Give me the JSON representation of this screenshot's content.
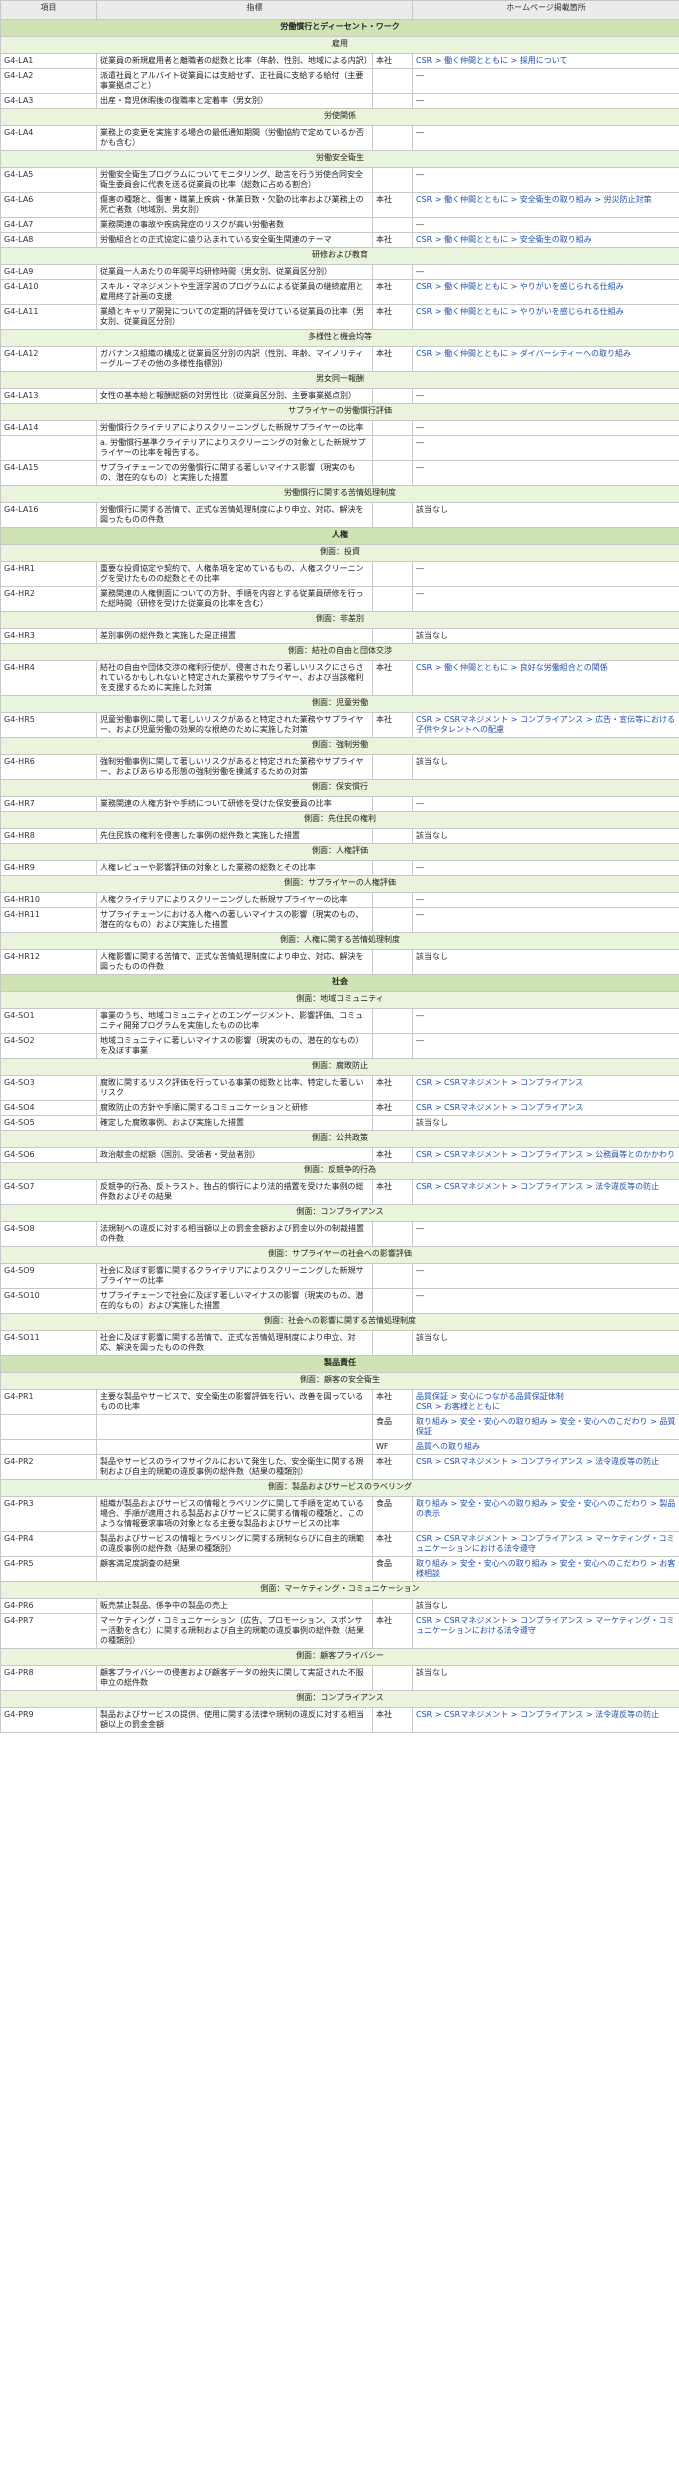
{
  "columns": [
    "項目",
    "指標",
    "",
    "ホームページ掲載箇所"
  ],
  "groups": [
    {
      "type": "section",
      "label": "労働慣行とディーセント・ワーク"
    },
    {
      "type": "sub",
      "label": "雇用"
    },
    {
      "type": "item",
      "code": "G4-LA1",
      "indicator": "従業員の新規雇用者と離職者の総数と比率（年齢、性別、地域による内訳）",
      "scope": "本社",
      "page": "CSR > 働く仲間とともに > 採用について"
    },
    {
      "type": "item",
      "code": "G4-LA2",
      "indicator": "派遣社員とアルバイト従業員には支給せず、正社員に支給する給付（主要事業拠点ごと）",
      "scope": "",
      "page": "―"
    },
    {
      "type": "item",
      "code": "G4-LA3",
      "indicator": "出産・育児休暇後の復職率と定着率（男女別）",
      "scope": "",
      "page": "―"
    },
    {
      "type": "sub",
      "label": "労使関係"
    },
    {
      "type": "item",
      "code": "G4-LA4",
      "indicator": "業務上の変更を実施する場合の最低通知期間（労働協約で定めているか否かも含む）",
      "scope": "",
      "page": "―"
    },
    {
      "type": "sub",
      "label": "労働安全衛生"
    },
    {
      "type": "item",
      "code": "G4-LA5",
      "indicator": "労働安全衛生プログラムについてモニタリング、助言を行う労使合同安全衛生委員会に代表を送る従業員の比率（総数に占める割合）",
      "scope": "",
      "page": "―"
    },
    {
      "type": "item",
      "code": "G4-LA6",
      "indicator": "傷害の種類と、傷害・職業上疾病・休業日数・欠勤の比率および業務上の死亡者数（地域別、男女別）",
      "scope": "本社",
      "page": "CSR > 働く仲間とともに > 安全衛生の取り組み > 労災防止対策"
    },
    {
      "type": "item",
      "code": "G4-LA7",
      "indicator": "業務関連の事故や疾病発症のリスクが高い労働者数",
      "scope": "",
      "page": "―"
    },
    {
      "type": "item",
      "code": "G4-LA8",
      "indicator": "労働組合との正式協定に盛り込まれている安全衛生関連のテーマ",
      "scope": "本社",
      "page": "CSR > 働く仲間とともに > 安全衛生の取り組み"
    },
    {
      "type": "sub",
      "label": "研修および教育"
    },
    {
      "type": "item",
      "code": "G4-LA9",
      "indicator": "従業員一人あたりの年間平均研修時間（男女別、従業員区分別）",
      "scope": "",
      "page": "―"
    },
    {
      "type": "item",
      "code": "G4-LA10",
      "indicator": "スキル・マネジメントや生涯学習のプログラムによる従業員の継続雇用と雇用終了計画の支援",
      "scope": "本社",
      "page": "CSR > 働く仲間とともに > やりがいを感じられる仕組み"
    },
    {
      "type": "item",
      "code": "G4-LA11",
      "indicator": "業績とキャリア開発についての定期的評価を受けている従業員の比率（男女別、従業員区分別）",
      "scope": "本社",
      "page": "CSR > 働く仲間とともに > やりがいを感じられる仕組み"
    },
    {
      "type": "sub",
      "label": "多様性と機会均等"
    },
    {
      "type": "item",
      "code": "G4-LA12",
      "indicator": "ガバナンス組織の構成と従業員区分別の内訳（性別、年齢、マイノリティーグループその他の多様性指標別）",
      "scope": "本社",
      "page": "CSR > 働く仲間とともに > ダイバーシティーへの取り組み"
    },
    {
      "type": "sub",
      "label": "男女同一報酬"
    },
    {
      "type": "item",
      "code": "G4-LA13",
      "indicator": "女性の基本給と報酬総額の対男性比（従業員区分別、主要事業拠点別）",
      "scope": "",
      "page": "―"
    },
    {
      "type": "sub",
      "label": "サプライヤーの労働慣行評価"
    },
    {
      "type": "item",
      "code": "G4-LA14",
      "indicator": "労働慣行クライテリアによりスクリーニングした新規サプライヤーの比率",
      "scope": "",
      "page": "―"
    },
    {
      "type": "item",
      "code": "",
      "indicator": "a. 労働慣行基準クライテリアによりスクリーニングの対象とした新規サプライヤーの比率を報告する。",
      "scope": "",
      "page": "―"
    },
    {
      "type": "item",
      "code": "G4-LA15",
      "indicator": "サプライチェーンでの労働慣行に関する著しいマイナス影響（現実のもの、潜在的なもの）と実施した措置",
      "scope": "",
      "page": "―"
    },
    {
      "type": "sub",
      "label": "労働慣行に関する苦情処理制度"
    },
    {
      "type": "item",
      "code": "G4-LA16",
      "indicator": "労働慣行に関する苦情で、正式な苦情処理制度により申立、対応、解決を図ったものの件数",
      "scope": "",
      "page": "該当なし"
    },
    {
      "type": "section",
      "label": "人権"
    },
    {
      "type": "sub",
      "label": "側面：投資"
    },
    {
      "type": "item",
      "code": "G4-HR1",
      "indicator": "重要な投資協定や契約で、人権条項を定めているもの、人権スクリーニングを受けたものの総数とその比率",
      "scope": "",
      "page": "―"
    },
    {
      "type": "item",
      "code": "G4-HR2",
      "indicator": "業務関連の人権側面についての方針、手順を内容とする従業員研修を行った総時間（研修を受けた従業員の比率を含む）",
      "scope": "",
      "page": "―"
    },
    {
      "type": "sub",
      "label": "側面：非差別"
    },
    {
      "type": "item",
      "code": "G4-HR3",
      "indicator": "差別事例の総件数と実施した是正措置",
      "scope": "",
      "page": "該当なし"
    },
    {
      "type": "sub",
      "label": "側面：結社の自由と団体交渉"
    },
    {
      "type": "item",
      "code": "G4-HR4",
      "indicator": "結社の自由や団体交渉の権利行使が、侵害されたり著しいリスクにさらされているかもしれないと特定された業務やサプライヤー、および当該権利を支援するために実施した対策",
      "scope": "本社",
      "page": "CSR > 働く仲間とともに > 良好な労働組合との関係"
    },
    {
      "type": "sub",
      "label": "側面：児童労働"
    },
    {
      "type": "item",
      "code": "G4-HR5",
      "indicator": "児童労働事例に関して著しいリスクがあると特定された業務やサプライヤー、および児童労働の効果的な根絶のために実施した対策",
      "scope": "本社",
      "page": "CSR > CSRマネジメント > コンプライアンス > 広告・宣伝等における子供やタレントへの配慮"
    },
    {
      "type": "sub",
      "label": "側面：強制労働"
    },
    {
      "type": "item",
      "code": "G4-HR6",
      "indicator": "強制労働事例に関して著しいリスクがあると特定された業務やサプライヤー、およびあらゆる形態の強制労働を撲滅するための対策",
      "scope": "",
      "page": "該当なし"
    },
    {
      "type": "sub",
      "label": "側面：保安慣行"
    },
    {
      "type": "item",
      "code": "G4-HR7",
      "indicator": "業務関連の人権方針や手続について研修を受けた保安要員の比率",
      "scope": "",
      "page": "―"
    },
    {
      "type": "sub",
      "label": "側面：先住民の権利"
    },
    {
      "type": "item",
      "code": "G4-HR8",
      "indicator": "先住民族の権利を侵害した事例の総件数と実施した措置",
      "scope": "",
      "page": "該当なし"
    },
    {
      "type": "sub",
      "label": "側面：人権評価"
    },
    {
      "type": "item",
      "code": "G4-HR9",
      "indicator": "人権レビューや影響評価の対象とした業務の総数とその比率",
      "scope": "",
      "page": "―"
    },
    {
      "type": "sub",
      "label": "側面：サプライヤーの人権評価"
    },
    {
      "type": "item",
      "code": "G4-HR10",
      "indicator": "人権クライテリアによりスクリーニングした新規サプライヤーの比率",
      "scope": "",
      "page": "―"
    },
    {
      "type": "item",
      "code": "G4-HR11",
      "indicator": "サプライチェーンにおける人権への著しいマイナスの影響（現実のもの、潜在的なもの）および実施した措置",
      "scope": "",
      "page": "―"
    },
    {
      "type": "sub",
      "label": "側面：人権に関する苦情処理制度"
    },
    {
      "type": "item",
      "code": "G4-HR12",
      "indicator": "人権影響に関する苦情で、正式な苦情処理制度により申立、対応、解決を図ったものの件数",
      "scope": "",
      "page": "該当なし"
    },
    {
      "type": "section",
      "label": "社会"
    },
    {
      "type": "sub",
      "label": "側面：地域コミュニティ"
    },
    {
      "type": "item",
      "code": "G4-SO1",
      "indicator": "事業のうち、地域コミュニティとのエンゲージメント、影響評価、コミュニティ開発プログラムを実施したものの比率",
      "scope": "",
      "page": "―"
    },
    {
      "type": "item",
      "code": "G4-SO2",
      "indicator": "地域コミュニティに著しいマイナスの影響（現実のもの、潜在的なもの）を及ぼす事業",
      "scope": "",
      "page": "―"
    },
    {
      "type": "sub",
      "label": "側面：腐敗防止"
    },
    {
      "type": "item",
      "code": "G4-SO3",
      "indicator": "腐敗に関するリスク評価を行っている事業の総数と比率、特定した著しいリスク",
      "scope": "本社",
      "page": "CSR > CSRマネジメント > コンプライアンス"
    },
    {
      "type": "item",
      "code": "G4-SO4",
      "indicator": "腐敗防止の方針や手順に関するコミュニケーションと研修",
      "scope": "本社",
      "page": "CSR > CSRマネジメント > コンプライアンス"
    },
    {
      "type": "item",
      "code": "G4-SO5",
      "indicator": "確定した腐敗事例、および実施した措置",
      "scope": "",
      "page": "該当なし"
    },
    {
      "type": "sub",
      "label": "側面：公共政策"
    },
    {
      "type": "item",
      "code": "G4-SO6",
      "indicator": "政治献金の総額（国別、受領者・受益者別）",
      "scope": "本社",
      "page": "CSR > CSRマネジメント > コンプライアンス > 公務員等とのかかわり"
    },
    {
      "type": "sub",
      "label": "側面：反競争的行為"
    },
    {
      "type": "item",
      "code": "G4-SO7",
      "indicator": "反競争的行為、反トラスト、独占的慣行により法的措置を受けた事例の総件数およびその結果",
      "scope": "本社",
      "page": "CSR > CSRマネジメント > コンプライアンス > 法令違反等の防止"
    },
    {
      "type": "sub",
      "label": "側面：コンプライアンス"
    },
    {
      "type": "item",
      "code": "G4-SO8",
      "indicator": "法規制への違反に対する相当額以上の罰金金額および罰金以外の制裁措置の件数",
      "scope": "",
      "page": "―"
    },
    {
      "type": "sub",
      "label": "側面：サプライヤーの社会への影響評価"
    },
    {
      "type": "item",
      "code": "G4-SO9",
      "indicator": "社会に及ぼす影響に関するクライテリアによりスクリーニングした新規サプライヤーの比率",
      "scope": "",
      "page": "―"
    },
    {
      "type": "item",
      "code": "G4-SO10",
      "indicator": "サプライチェーンで社会に及ぼす著しいマイナスの影響（現実のもの、潜在的なもの）および実施した措置",
      "scope": "",
      "page": "―"
    },
    {
      "type": "sub",
      "label": "側面：社会への影響に関する苦情処理制度"
    },
    {
      "type": "item",
      "code": "G4-SO11",
      "indicator": "社会に及ぼす影響に関する苦情で、正式な苦情処理制度により申立、対応、解決を図ったものの件数",
      "scope": "",
      "page": "該当なし"
    },
    {
      "type": "section",
      "label": "製品責任"
    },
    {
      "type": "sub",
      "label": "側面：顧客の安全衛生"
    },
    {
      "type": "item",
      "code": "G4-PR1",
      "indicator": "主要な製品やサービスで、安全衛生の影響評価を行い、改善を図っているものの比率",
      "scope": "本社",
      "page": "品質保証 > 安心につながる品質保証体制\nCSR > お客様とともに"
    },
    {
      "type": "item",
      "code": "",
      "indicator": "",
      "scope": "食品",
      "page": "取り組み > 安全・安心への取り組み > 安全・安心へのこだわり > 品質保証"
    },
    {
      "type": "item",
      "code": "",
      "indicator": "",
      "scope": "WF",
      "page": "品質への取り組み"
    },
    {
      "type": "item",
      "code": "G4-PR2",
      "indicator": "製品やサービスのライフサイクルにおいて発生した、安全衛生に関する規制および自主的規範の違反事例の総件数（結果の種類別）",
      "scope": "本社",
      "page": "CSR > CSRマネジメント > コンプライアンス > 法令違反等の防止"
    },
    {
      "type": "sub",
      "label": "側面：製品およびサービスのラベリング"
    },
    {
      "type": "item",
      "code": "G4-PR3",
      "indicator": "組織が製品およびサービスの情報とラベリングに関して手順を定めている場合、手順が適用される製品およびサービスに関する情報の種類と、このような情報要求事項の対象となる主要な製品およびサービスの比率",
      "scope": "食品",
      "page": "取り組み > 安全・安心への取り組み > 安全・安心へのこだわり > 製品の表示"
    },
    {
      "type": "item",
      "code": "G4-PR4",
      "indicator": "製品およびサービスの情報とラベリングに関する規制ならびに自主的規範の違反事例の総件数（結果の種類別）",
      "scope": "本社",
      "page": "CSR > CSRマネジメント > コンプライアンス > マーケティング・コミュニケーションにおける法令遵守"
    },
    {
      "type": "item",
      "code": "G4-PR5",
      "indicator": "顧客満足度調査の結果",
      "scope": "食品",
      "page": "取り組み > 安全・安心への取り組み > 安全・安心へのこだわり > お客様相談"
    },
    {
      "type": "sub",
      "label": "側面：マーケティング・コミュニケーション"
    },
    {
      "type": "item",
      "code": "G4-PR6",
      "indicator": "販売禁止製品、係争中の製品の売上",
      "scope": "",
      "page": "該当なし"
    },
    {
      "type": "item",
      "code": "G4-PR7",
      "indicator": "マーケティング・コミュニケーション（広告、プロモーション、スポンサー活動を含む）に関する規制および自主的規範の違反事例の総件数（結果の種類別）",
      "scope": "本社",
      "page": "CSR > CSRマネジメント > コンプライアンス > マーケティング・コミュニケーションにおける法令遵守"
    },
    {
      "type": "sub",
      "label": "側面：顧客プライバシー"
    },
    {
      "type": "item",
      "code": "G4-PR8",
      "indicator": "顧客プライバシーの侵害および顧客データの紛失に関して実証された不服申立の総件数",
      "scope": "",
      "page": "該当なし"
    },
    {
      "type": "sub",
      "label": "側面：コンプライアンス"
    },
    {
      "type": "item",
      "code": "G4-PR9",
      "indicator": "製品およびサービスの提供、使用に関する法律や規制の違反に対する相当額以上の罰金金額",
      "scope": "本社",
      "page": "CSR > CSRマネジメント > コンプライアンス > 法令違反等の防止"
    }
  ]
}
